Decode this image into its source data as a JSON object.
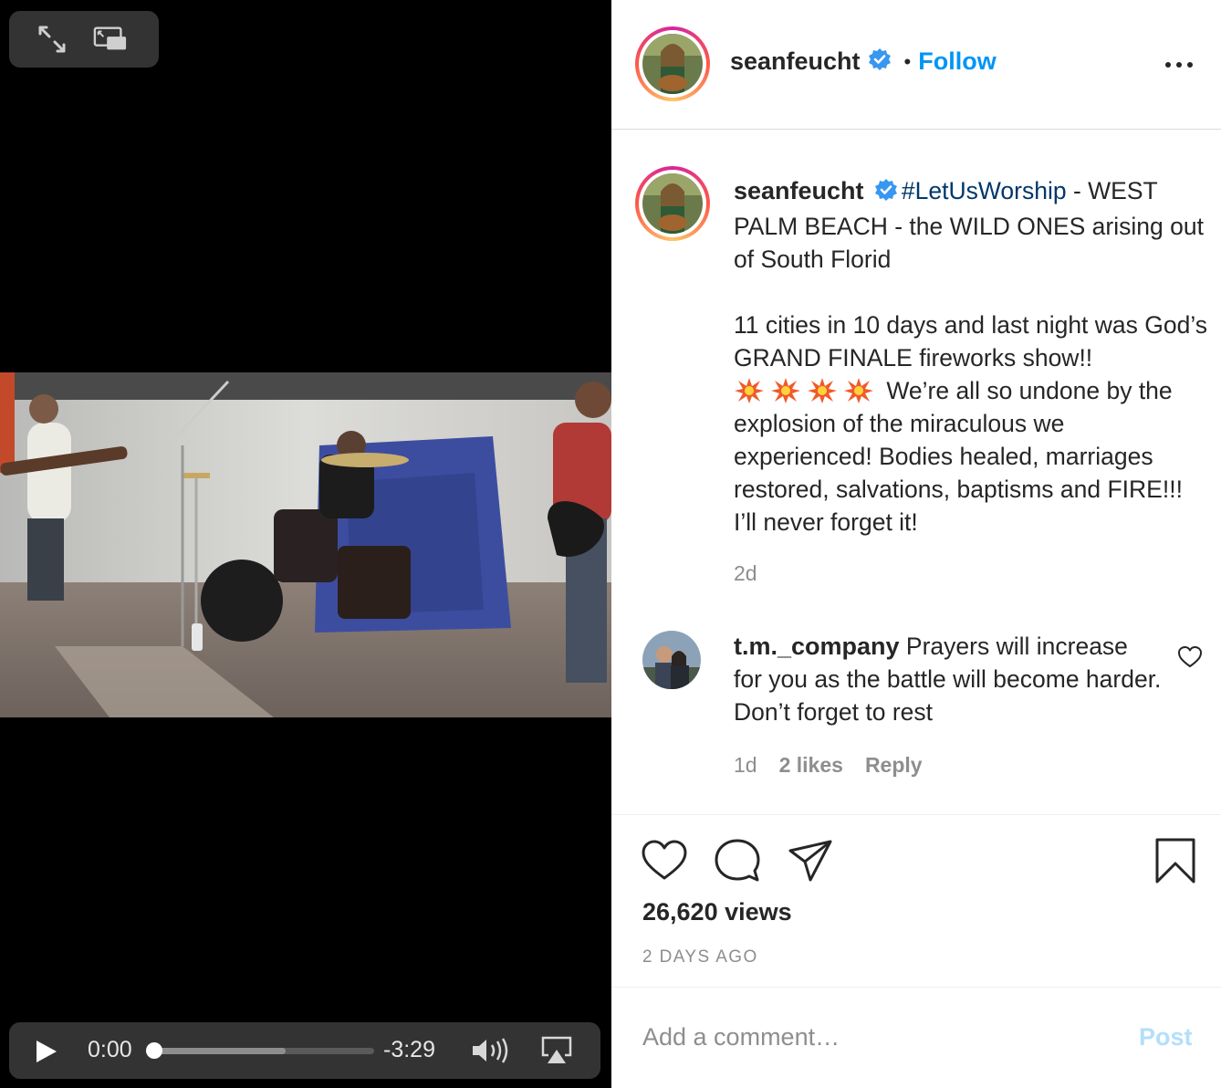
{
  "video": {
    "current_time": "0:00",
    "remaining_time": "-3:29",
    "progress_fraction": 0.0,
    "buffered_fraction": 0.6
  },
  "header": {
    "username": "seanfeucht",
    "separator": "•",
    "follow_label": "Follow"
  },
  "caption": {
    "username": "seanfeucht",
    "hashtag": "#LetUsWorship",
    "text_line1": " - WEST PALM BEACH - the WILD ONES arising out of South Florid",
    "text_para2": "11 cities in 10 days and last night was God’s GRAND FINALE fireworks show!!",
    "text_after_emoji": " We’re all so undone by the explosion of the miraculous we experienced! Bodies healed, marriages restored, salvations, baptisms and FIRE!!! I’ll never forget it!",
    "age": "2d"
  },
  "comment": {
    "username": "t.m._company",
    "text": " Prayers will increase for you as the battle will become harder. Don’t forget to rest",
    "age": "1d",
    "likes": "2 likes",
    "reply_label": "Reply"
  },
  "stats": {
    "views": "26,620 views",
    "posted": "2 DAYS AGO"
  },
  "compose": {
    "placeholder": "Add a comment…",
    "post_label": "Post"
  },
  "colors": {
    "follow": "#0095f6",
    "hashtag": "#00376b",
    "verified": "#3897f0",
    "post_disabled": "#b2dffc"
  }
}
